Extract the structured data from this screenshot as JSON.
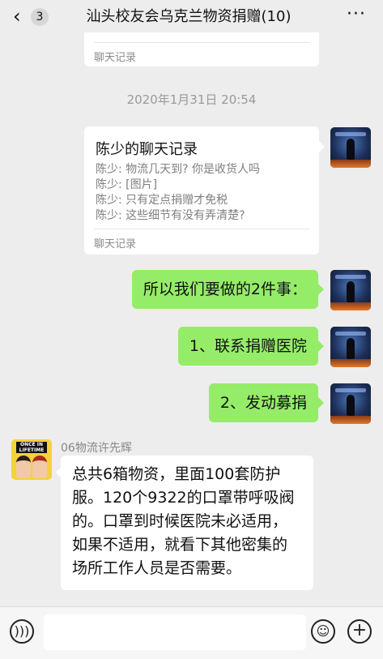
{
  "header": {
    "back_glyph": "‹",
    "unread_count": "3",
    "title": "汕头校友会乌克兰物资捐赠(10)",
    "more_glyph": "···"
  },
  "partial_card": {
    "footer": "聊天记录"
  },
  "timestamp": "2020年1月31日 20:54",
  "chat_record": {
    "title": "陈少的聊天记录",
    "lines": [
      "陈少: 物流几天到? 你是收货人吗",
      "陈少: [图片]",
      "陈少: 只有定点捐赠才免税",
      "陈少: 这些细节有没有弄清楚?"
    ],
    "footer": "聊天记录"
  },
  "messages_self": [
    {
      "text": "所以我们要做的2件事："
    },
    {
      "text": "1、联系捐赠医院"
    },
    {
      "text": "2、发动募捐"
    }
  ],
  "message_other": {
    "sender": "06物流许先辉",
    "avatar_sign": "ONCE IN LIFETIME",
    "text": "总共6箱物资，里面100套防护服。120个9322的口罩带呼吸阀的。口罩到时候医院未必适用，如果不适用，就看下其他密集的场所工作人员是否需要。"
  },
  "input_bar": {
    "voice_icon": "voice-icon",
    "emoji_icon": "emoji-icon",
    "plus_icon": "plus-icon"
  },
  "colors": {
    "background": "#ededed",
    "bubble_self": "#95ec69",
    "bubble_other": "#ffffff"
  }
}
